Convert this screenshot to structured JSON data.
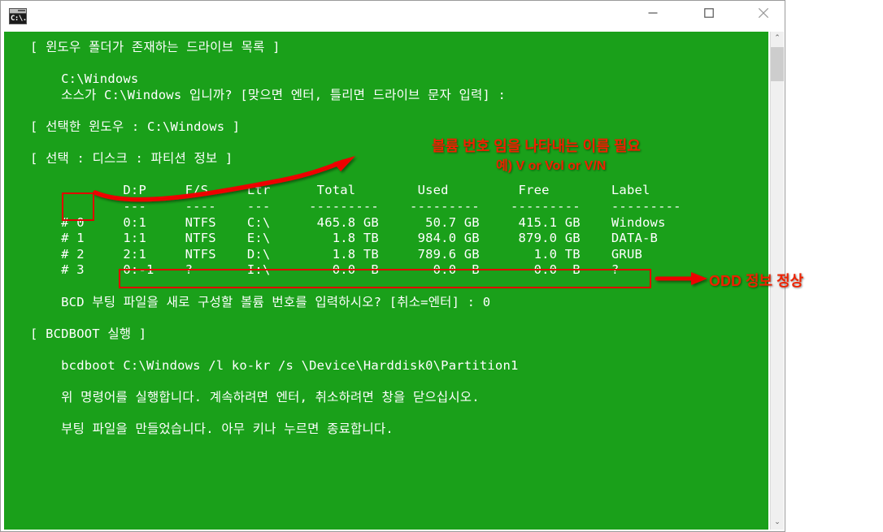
{
  "window": {
    "title": "",
    "icon_name": "cmd-prompt-icon",
    "icon_label": "C:\\.",
    "controls": {
      "minimize": "—",
      "maximize": "□",
      "close": "✕"
    }
  },
  "scrollbar": {
    "up_arrow": "⌃",
    "down_arrow": "⌄"
  },
  "colors": {
    "console_background": "#1aa01a",
    "console_foreground": "#ffffff",
    "annotation_red": "#ee2200",
    "annotation_box": "#e00000"
  },
  "console": {
    "text": "[ 윈도우 폴더가 존재하는 드라이브 목록 ]\n\n    C:\\Windows\n    소스가 C:\\Windows 입니까? [맞으면 엔터, 틀리면 드라이브 문자 입력] :\n\n[ 선택한 윈도우 : C:\\Windows ]\n\n[ 선택 : 디스크 : 파티션 정보 ]\n\n            D:P     F/S     Ltr      Total        Used         Free        Label\n            ---     ----    ---     ---------    ---------    ---------    ---------\n    # 0     0:1     NTFS    C:\\      465.8 GB      50.7 GB     415.1 GB    Windows\n    # 1     1:1     NTFS    E:\\        1.8 TB     984.0 GB     879.0 GB    DATA-B\n    # 2     2:1     NTFS    D:\\        1.8 TB     789.6 GB       1.0 TB    GRUB\n    # 3     0:-1    ?       I:\\        0.0  B       0.0  B       0.0  B    ?\n\n    BCD 부팅 파일을 새로 구성할 볼륨 번호를 입력하시오? [취소=엔터] : 0\n\n[ BCDBOOT 실행 ]\n\n    bcdboot C:\\Windows /l ko-kr /s \\Device\\Harddisk0\\Partition1\n\n    위 명령어를 실행합니다. 계속하려면 엔터, 취소하려면 창을 닫으십시오.\n\n    부팅 파일을 만들었습니다. 아무 키나 누르면 종료합니다."
  },
  "console_lines": {
    "header_drive_list": "[ 윈도우 폴더가 존재하는 드라이브 목록 ]",
    "source_path": "C:\\Windows",
    "source_prompt": "소스가 C:\\Windows 입니까? [맞으면 엔터, 틀리면 드라이브 문자 입력] :",
    "selected_windows": "[ 선택한 윈도우 : C:\\Windows ]",
    "partition_info_header": "[ 선택 : 디스크 : 파티션 정보 ]",
    "volume_prompt": "BCD 부팅 파일을 새로 구성할 볼륨 번호를 입력하시오? [취소=엔터] : 0",
    "bcdboot_header": "[ BCDBOOT 실행 ]",
    "bcdboot_command": "bcdboot C:\\Windows /l ko-kr /s \\Device\\Harddisk0\\Partition1",
    "execute_notice": "위 명령어를 실행합니다. 계속하려면 엔터, 취소하려면 창을 닫으십시오.",
    "completion_notice": "부팅 파일을 만들었습니다. 아무 키나 누르면 종료합니다."
  },
  "partition_table": {
    "columns": [
      "#",
      "D:P",
      "F/S",
      "Ltr",
      "Total",
      "Used",
      "Free",
      "Label"
    ],
    "separators": [
      "",
      "---",
      "----",
      "---",
      "---------",
      "---------",
      "---------",
      "---------"
    ],
    "rows": [
      {
        "index": "# 0",
        "dp": "0:1",
        "fs": "NTFS",
        "ltr": "C:\\",
        "total": "465.8 GB",
        "used": "50.7 GB",
        "free": "415.1 GB",
        "label": "Windows"
      },
      {
        "index": "# 1",
        "dp": "1:1",
        "fs": "NTFS",
        "ltr": "E:\\",
        "total": "1.8 TB",
        "used": "984.0 GB",
        "free": "879.0 GB",
        "label": "DATA-B"
      },
      {
        "index": "# 2",
        "dp": "2:1",
        "fs": "NTFS",
        "ltr": "D:\\",
        "total": "1.8 TB",
        "used": "789.6 GB",
        "free": "1.0 TB",
        "label": "GRUB"
      },
      {
        "index": "# 3",
        "dp": "0:-1",
        "fs": "?",
        "ltr": "I:\\",
        "total": "0.0  B",
        "used": "0.0  B",
        "free": "0.0  B",
        "label": "?"
      }
    ]
  },
  "annotations": {
    "volume_label_line1": "볼륨 번호 임을 나타내는 이름 필요",
    "volume_label_line2": "예) V or Vol or V/N",
    "odd_note": "ODD 정보 정상"
  }
}
